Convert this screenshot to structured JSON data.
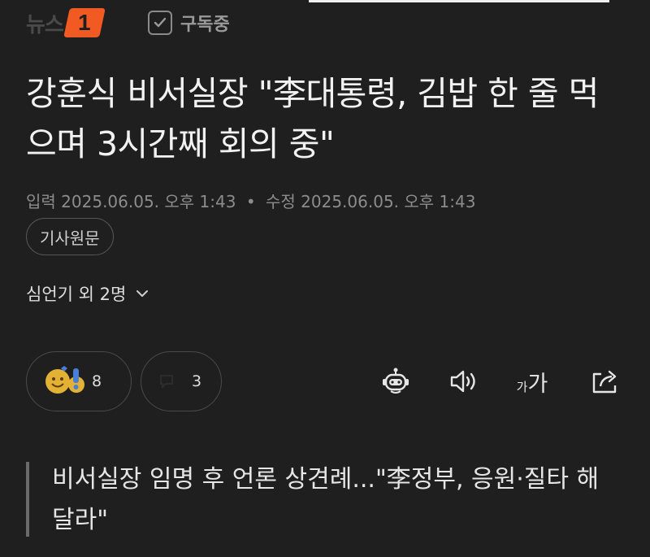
{
  "header": {
    "logo_text": "뉴스",
    "logo_mark": "1",
    "subscribe_label": "구독중"
  },
  "article": {
    "title": "강훈식 비서실장 \"李대통령, 김밥 한 줄 먹으며 3시간째 회의 중\"",
    "published_label": "입력",
    "published": "2025.06.05. 오후 1:43",
    "separator": "•",
    "modified_label": "수정",
    "modified": "2025.06.05. 오후 1:43",
    "original_button": "기사원문",
    "authors": "심언기 외 2명",
    "subtitle": "비서실장 임명 후 언론 상견례...\"李정부, 응원·질타 해달라\""
  },
  "reactions": {
    "emotion_count": "8",
    "comment_count": "3"
  },
  "toolbar": {
    "font_size_small": "가",
    "font_size_large": "가",
    "icons": [
      "robot-summary-icon",
      "speaker-icon",
      "font-size-icon",
      "share-icon"
    ]
  },
  "colors": {
    "background": "#1f1f1f",
    "brand_orange": "#f15a22",
    "text_primary": "#f2f2f2",
    "text_muted": "#8c8c8c"
  }
}
